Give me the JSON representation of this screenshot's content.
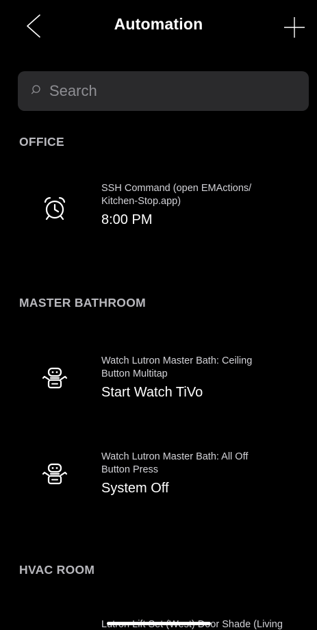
{
  "header": {
    "title": "Automation",
    "back_icon": "chevron-left-icon",
    "add_icon": "plus-icon"
  },
  "search": {
    "placeholder": "Search",
    "value": ""
  },
  "sections": [
    {
      "title": "OFFICE",
      "items": [
        {
          "icon": "alarm-clock-icon",
          "subtitle": "SSH Command (open EMActions/\nKitchen-Stop.app)",
          "title": "8:00 PM"
        }
      ]
    },
    {
      "title": "MASTER BATHROOM",
      "items": [
        {
          "icon": "robot-icon",
          "subtitle": "Watch Lutron Master Bath: Ceiling\nButton Multitap",
          "title": "Start Watch TiVo"
        },
        {
          "icon": "robot-icon",
          "subtitle": "Watch Lutron Master Bath: All Off\nButton Press",
          "title": "System Off"
        }
      ]
    },
    {
      "title": "HVAC ROOM",
      "items": [
        {
          "subtitle": "Lutron Lift Set (West) Door Shade (Living"
        }
      ]
    }
  ],
  "colors": {
    "background": "#000000",
    "search_field": "#2a2a2c",
    "section_header": "#b8b8bd",
    "text_primary": "#ffffff",
    "text_secondary": "#d2d2d7",
    "placeholder": "#8e8e93"
  }
}
